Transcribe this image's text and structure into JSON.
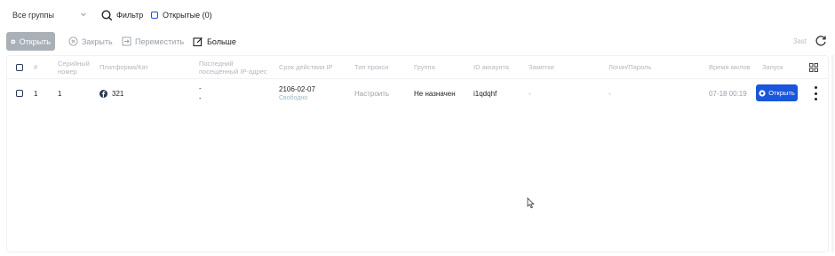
{
  "topbar": {
    "group_select": "Все группы",
    "filter_label": "Фильтр",
    "opened_label": "Открытые (0)"
  },
  "toolbar": {
    "open_label": "Открыть",
    "close_label": "Закрыть",
    "move_label": "Переместить",
    "more_label": "Больше",
    "page_label": "3ast"
  },
  "table": {
    "columns": {
      "num": "#",
      "serial": "Серийный номер",
      "platform": "Платформа/Кат",
      "last_ip": "Последний посещённый IP-адрес",
      "ip_term": "Срок действия IP",
      "proxy_type": "Тип прокси",
      "group": "Группа",
      "account_id": "ID аккаунта",
      "notes": "Заметки",
      "login_pass": "Логин/Пароль",
      "time": "Время милов",
      "launch": "Запуск"
    },
    "rows": [
      {
        "num": "1",
        "serial": "1",
        "platform": "321",
        "last_ip_1": "-",
        "last_ip_2": "-",
        "ip_date": "2106-02-07",
        "ip_status": "Свободно",
        "proxy": "Настроить",
        "group": "Не назначен",
        "account_id": "i1qdqhf",
        "notes": "-",
        "login_pass": "-",
        "time": "07-18 00:19",
        "launch_label": "Открыть"
      }
    ]
  },
  "colors": {
    "primary": "#1a56db",
    "disabled_button": "#aab0b8",
    "header_text": "#b4b8be"
  }
}
